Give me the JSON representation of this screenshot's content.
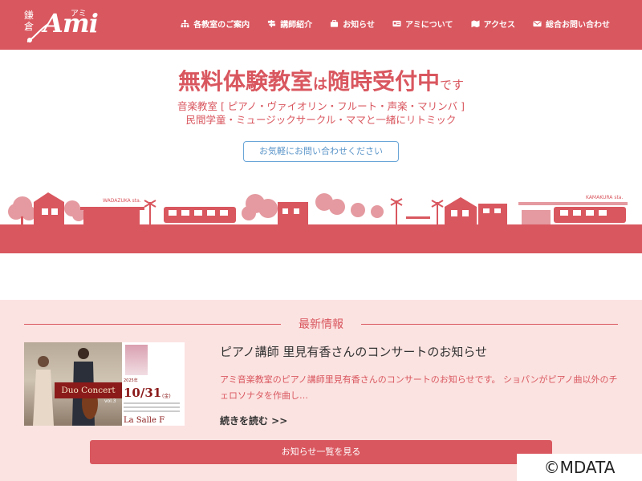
{
  "header": {
    "logo": {
      "kanji": "鎌倉",
      "wordmark": "Ami",
      "kana": "アミ"
    },
    "nav": [
      {
        "label": "各教室のご案内",
        "icon": "sitemap-icon"
      },
      {
        "label": "講師紹介",
        "icon": "signpost-icon"
      },
      {
        "label": "お知らせ",
        "icon": "briefcase-icon"
      },
      {
        "label": "アミについて",
        "icon": "id-card-icon"
      },
      {
        "label": "アクセス",
        "icon": "map-icon"
      },
      {
        "label": "総合お問い合わせ",
        "icon": "envelope-icon"
      }
    ]
  },
  "hero": {
    "title_part1": "無料体験教室",
    "title_part2": "は",
    "title_part3": "随時受付中",
    "title_part4": "です",
    "sub1": "音楽教室 [ ピアノ・ヴァイオリン・フルート・声楽・マリンバ ]",
    "sub2": "民間学童・ミュージックサークル・ママと一緒にリトミック",
    "contact_button": "お気軽にお問い合わせください"
  },
  "town": {
    "station_left": "WADAZUKA sta.",
    "station_right": "KAMAKURA sta."
  },
  "news": {
    "heading": "最新情報",
    "thumbnail": {
      "year": "2025年",
      "date": "10/31",
      "weekday": "(金)",
      "concert": "Duo Concert",
      "vol": "vol.3",
      "venue": "La Salle F"
    },
    "item_title": "ピアノ講師 里見有香さんのコンサートのお知らせ",
    "item_excerpt": "アミ音楽教室のピアノ講師里見有香さんのコンサートのお知らせです。 ショパンがピアノ曲以外のチェロソナタを作曲し…",
    "read_more": "続きを読む >>",
    "all_button": "お知らせ一覧を見る"
  },
  "watermark": "©MDATA",
  "colors": {
    "brand": "#d9575f",
    "news_bg": "#fbe3e1",
    "link_blue": "#5b95c9"
  }
}
